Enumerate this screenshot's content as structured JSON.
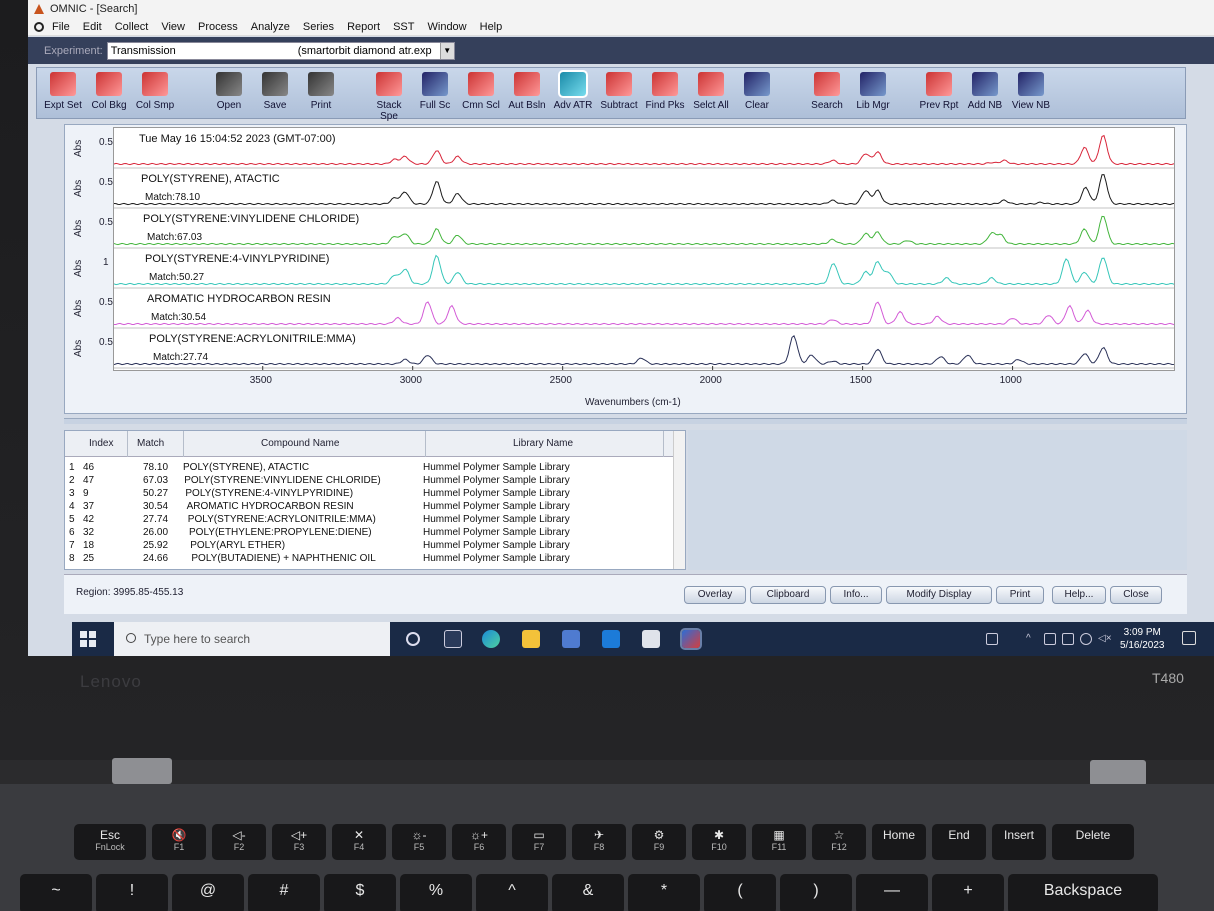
{
  "window": {
    "title": "OMNIC - [Search]"
  },
  "menu": [
    "File",
    "Edit",
    "Collect",
    "View",
    "Process",
    "Analyze",
    "Series",
    "Report",
    "SST",
    "Window",
    "Help"
  ],
  "experiment": {
    "label": "Experiment:",
    "value": "Transmission",
    "file": "(smartorbit diamond atr.exp"
  },
  "toolbar": [
    {
      "label": "Expt Set",
      "icon": "expt-set-icon"
    },
    {
      "label": "Col Bkg",
      "icon": "collect-background-icon"
    },
    {
      "label": "Col Smp",
      "icon": "collect-sample-icon"
    },
    {
      "label": "Open",
      "icon": "open-icon"
    },
    {
      "label": "Save",
      "icon": "save-icon"
    },
    {
      "label": "Print",
      "icon": "print-icon"
    },
    {
      "label": "Stack Spe",
      "icon": "stack-spectra-icon"
    },
    {
      "label": "Full Sc",
      "icon": "full-scale-icon"
    },
    {
      "label": "Cmn Scl",
      "icon": "common-scale-icon"
    },
    {
      "label": "Aut Bsln",
      "icon": "auto-baseline-icon"
    },
    {
      "label": "Adv ATR",
      "icon": "advanced-atr-icon"
    },
    {
      "label": "Subtract",
      "icon": "subtract-icon"
    },
    {
      "label": "Find Pks",
      "icon": "find-peaks-icon"
    },
    {
      "label": "Selct All",
      "icon": "select-all-icon"
    },
    {
      "label": "Clear",
      "icon": "clear-icon"
    },
    {
      "label": "Search",
      "icon": "search-icon"
    },
    {
      "label": "Lib Mgr",
      "icon": "library-manager-icon"
    },
    {
      "label": "Prev Rpt",
      "icon": "preview-report-icon"
    },
    {
      "label": "Add NB",
      "icon": "add-notebook-icon"
    },
    {
      "label": "View NB",
      "icon": "view-notebook-icon"
    }
  ],
  "chart_data": {
    "type": "line",
    "xlabel": "Wavenumbers (cm-1)",
    "ylabel": "Abs",
    "xlim": [
      3995.85,
      455.13
    ],
    "x_ticks": [
      3500,
      3000,
      2500,
      2000,
      1500,
      1000
    ],
    "strips": [
      {
        "title": "Tue May 16 15:04:52 2023 (GMT-07:00)",
        "match": "",
        "ytick": "0.5",
        "color": "#d8263a",
        "peaks": [
          [
            3060,
            0.15
          ],
          [
            3025,
            0.25
          ],
          [
            2920,
            0.45
          ],
          [
            2850,
            0.25
          ],
          [
            1600,
            0.12
          ],
          [
            1490,
            0.35
          ],
          [
            1450,
            0.4
          ],
          [
            1070,
            0.05
          ],
          [
            1028,
            0.12
          ],
          [
            760,
            0.55
          ],
          [
            698,
            0.95
          ]
        ]
      },
      {
        "title": "POLY(STYRENE), ATACTIC",
        "match": "Match:78.10",
        "ytick": "0.5",
        "color": "#1a1a1a",
        "peaks": [
          [
            3060,
            0.2
          ],
          [
            3025,
            0.4
          ],
          [
            2920,
            0.75
          ],
          [
            2850,
            0.35
          ],
          [
            1600,
            0.12
          ],
          [
            1490,
            0.45
          ],
          [
            1450,
            0.45
          ],
          [
            1028,
            0.12
          ],
          [
            905,
            0.05
          ],
          [
            756,
            0.55
          ],
          [
            698,
            1.0
          ]
        ]
      },
      {
        "title": "POLY(STYRENE:VINYLIDENE CHLORIDE)",
        "match": "Match:67.03",
        "ytick": "0.5",
        "color": "#43b53c",
        "peaks": [
          [
            3060,
            0.25
          ],
          [
            3025,
            0.35
          ],
          [
            2920,
            0.5
          ],
          [
            2850,
            0.3
          ],
          [
            1600,
            0.15
          ],
          [
            1490,
            0.35
          ],
          [
            1450,
            0.4
          ],
          [
            1350,
            0.12
          ],
          [
            1070,
            0.35
          ],
          [
            1040,
            0.3
          ],
          [
            760,
            0.5
          ],
          [
            698,
            0.95
          ]
        ]
      },
      {
        "title": "POLY(STYRENE:4-VINYLPYRIDINE)",
        "match": "Match:50.27",
        "ytick": "1",
        "color": "#36c6b9",
        "peaks": [
          [
            3060,
            0.3
          ],
          [
            3025,
            0.5
          ],
          [
            2920,
            0.95
          ],
          [
            2850,
            0.4
          ],
          [
            1597,
            0.7
          ],
          [
            1490,
            0.4
          ],
          [
            1450,
            0.75
          ],
          [
            1415,
            0.4
          ],
          [
            1220,
            0.2
          ],
          [
            1070,
            0.2
          ],
          [
            820,
            0.85
          ],
          [
            760,
            0.4
          ],
          [
            698,
            0.9
          ]
        ]
      },
      {
        "title": "AROMATIC HYDROCARBON RESIN",
        "match": "Match:30.54",
        "ytick": "0.5",
        "color": "#d35bd6",
        "peaks": [
          [
            3050,
            0.2
          ],
          [
            2950,
            0.75
          ],
          [
            2870,
            0.6
          ],
          [
            1600,
            0.15
          ],
          [
            1450,
            0.75
          ],
          [
            1375,
            0.4
          ],
          [
            1250,
            0.25
          ],
          [
            1000,
            0.2
          ],
          [
            880,
            0.3
          ],
          [
            810,
            0.6
          ],
          [
            750,
            0.45
          ]
        ]
      },
      {
        "title": "POLY(STYRENE:ACRYLONITRILE:MMA)",
        "match": "Match:27.74",
        "ytick": "0.5",
        "color": "#2a3158",
        "peaks": [
          [
            3025,
            0.15
          ],
          [
            2950,
            0.3
          ],
          [
            2237,
            0.2
          ],
          [
            1730,
            0.95
          ],
          [
            1670,
            0.3
          ],
          [
            1600,
            0.1
          ],
          [
            1450,
            0.5
          ],
          [
            1240,
            0.25
          ],
          [
            1150,
            0.3
          ],
          [
            980,
            0.15
          ],
          [
            760,
            0.35
          ],
          [
            698,
            0.55
          ]
        ]
      }
    ]
  },
  "table": {
    "headers": [
      "Index",
      "Match",
      "Compound Name",
      "Library Name"
    ],
    "rows": [
      {
        "n": "1",
        "index": "46",
        "match": "78.10",
        "name": "POLY(STYRENE), ATACTIC",
        "library": "Hummel Polymer Sample Library"
      },
      {
        "n": "2",
        "index": "47",
        "match": "67.03",
        "name": "POLY(STYRENE:VINYLIDENE CHLORIDE)",
        "library": "Hummel Polymer Sample Library"
      },
      {
        "n": "3",
        "index": "9",
        "match": "50.27",
        "name": "POLY(STYRENE:4-VINYLPYRIDINE)",
        "library": "Hummel Polymer Sample Library"
      },
      {
        "n": "4",
        "index": "37",
        "match": "30.54",
        "name": "AROMATIC HYDROCARBON RESIN",
        "library": "Hummel Polymer Sample Library"
      },
      {
        "n": "5",
        "index": "42",
        "match": "27.74",
        "name": "POLY(STYRENE:ACRYLONITRILE:MMA)",
        "library": "Hummel Polymer Sample Library"
      },
      {
        "n": "6",
        "index": "32",
        "match": "26.00",
        "name": "POLY(ETHYLENE:PROPYLENE:DIENE)",
        "library": "Hummel Polymer Sample Library"
      },
      {
        "n": "7",
        "index": "18",
        "match": "25.92",
        "name": "POLY(ARYL ETHER)",
        "library": "Hummel Polymer Sample Library"
      },
      {
        "n": "8",
        "index": "25",
        "match": "24.66",
        "name": "POLY(BUTADIENE) + NAPHTHENIC OIL",
        "library": "Hummel Polymer Sample Library"
      }
    ]
  },
  "status": {
    "region": "Region:  3995.85-455.13"
  },
  "buttons": [
    "Overlay",
    "Clipboard",
    "Info...",
    "Modify Display",
    "Print",
    "Help...",
    "Close"
  ],
  "taskbar": {
    "search_placeholder": "Type here to search",
    "time": "3:09 PM",
    "date": "5/16/2023"
  },
  "laptop": {
    "brand": "Lenovo",
    "model": "T480"
  },
  "keyboard": {
    "fkeys": [
      {
        "top": "Esc",
        "sub": "FnLock"
      },
      {
        "top": "🔇",
        "sub": "F1"
      },
      {
        "top": "◁-",
        "sub": "F2"
      },
      {
        "top": "◁+",
        "sub": "F3"
      },
      {
        "top": "✕",
        "sub": "F4"
      },
      {
        "top": "☼-",
        "sub": "F5"
      },
      {
        "top": "☼+",
        "sub": "F6"
      },
      {
        "top": "▭",
        "sub": "F7"
      },
      {
        "top": "✈",
        "sub": "F8"
      },
      {
        "top": "⚙",
        "sub": "F9"
      },
      {
        "top": "✱",
        "sub": "F10"
      },
      {
        "top": "▦",
        "sub": "F11"
      },
      {
        "top": "☆",
        "sub": "F12"
      },
      {
        "top": "Home",
        "sub": ""
      },
      {
        "top": "End",
        "sub": ""
      },
      {
        "top": "Insert",
        "sub": ""
      },
      {
        "top": "Delete",
        "sub": ""
      }
    ],
    "numrow": [
      "~",
      "!",
      "@",
      "#",
      "$",
      "%",
      "^",
      "&",
      "*",
      "(",
      ")",
      "—",
      "+",
      "Backspace"
    ]
  }
}
